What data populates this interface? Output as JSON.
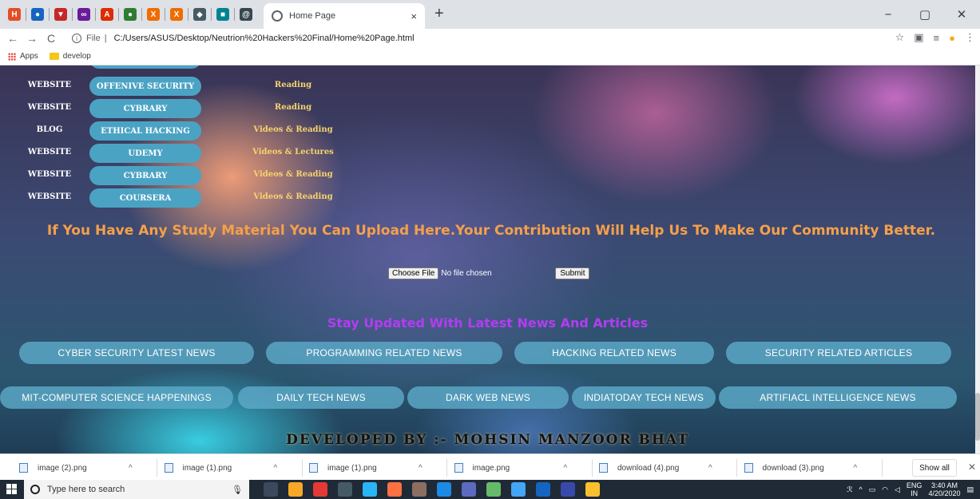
{
  "browser": {
    "pinned_tabs": [
      {
        "icon": "html-icon",
        "color": "#e44d26",
        "glyph": "H"
      },
      {
        "icon": "circle-icon",
        "color": "#1565c0",
        "glyph": "●"
      },
      {
        "icon": "shield-icon",
        "color": "#c62828",
        "glyph": "▼"
      },
      {
        "icon": "infinity-icon",
        "color": "#6a1b9a",
        "glyph": "∞"
      },
      {
        "icon": "angular-icon",
        "color": "#dd2c00",
        "glyph": "A"
      },
      {
        "icon": "whatsapp-icon",
        "color": "#2e7d32",
        "glyph": "●"
      },
      {
        "icon": "x-icon",
        "color": "#ef6c00",
        "glyph": "X"
      },
      {
        "icon": "x-icon",
        "color": "#ef6c00",
        "glyph": "X"
      },
      {
        "icon": "diamond-icon",
        "color": "#455a64",
        "glyph": "◆"
      },
      {
        "icon": "square-icon",
        "color": "#00838f",
        "glyph": "■"
      },
      {
        "icon": "at-icon",
        "color": "#37474f",
        "glyph": "@"
      }
    ],
    "active_tab_title": "Home Page",
    "tab_close": "×",
    "new_tab": "+",
    "window_controls": {
      "minimize": "−",
      "maximize": "▢",
      "close": "✕"
    },
    "back": "←",
    "forward": "→",
    "reload": "C",
    "url_scheme": "File",
    "url": "C:/Users/ASUS/Desktop/Neutrion%20Hackers%20Final/Home%20Page.html",
    "bookmarks": [
      {
        "label": "Apps",
        "icon": "apps-icon"
      },
      {
        "label": "develop",
        "icon": "folder-icon"
      }
    ]
  },
  "resources": [
    {
      "type": "WEBSITE",
      "name": "OFFENIVE SECURITY",
      "kind": "Reading"
    },
    {
      "type": "WEBSITE",
      "name": "CYBRARY",
      "kind": "Reading"
    },
    {
      "type": "BLOG",
      "name": "ETHICAL HACKING",
      "kind": "Videos & Reading"
    },
    {
      "type": "WEBSITE",
      "name": "UDEMY",
      "kind": "Videos & Lectures"
    },
    {
      "type": "WEBSITE",
      "name": "CYBRARY",
      "kind": "Videos & Reading"
    },
    {
      "type": "WEBSITE",
      "name": "COURSERA",
      "kind": "Videos & Reading"
    }
  ],
  "upload": {
    "heading": "If You Have Any Study Material You Can Upload Here.Your Contribution Will Help Us To Make Our Community Better.",
    "choose_label": "Choose File",
    "no_file": "No file chosen",
    "submit_label": "Submit"
  },
  "news": {
    "heading": "Stay Updated With Latest News And Articles",
    "row1": [
      "CYBER SECURITY LATEST NEWS",
      "PROGRAMMING RELATED NEWS",
      "HACKING RELATED NEWS",
      "SECURITY RELATED ARTICLES"
    ],
    "row2": [
      "MIT-COMPUTER SCIENCE HAPPENINGS",
      "DAILY TECH NEWS",
      "DARK WEB NEWS",
      "INDIATODAY TECH NEWS",
      "ARTIFIACL INTELLIGENCE NEWS"
    ]
  },
  "footer_credit": "DEVELOPED BY :- MOHSIN MANZOOR BHAT",
  "downloads": {
    "items": [
      "image (2).png",
      "image (1).png",
      "image (1).png",
      "image.png",
      "download (4).png",
      "download (3).png"
    ],
    "chevron": "^",
    "show_all": "Show all",
    "close": "✕"
  },
  "taskbar": {
    "search_placeholder": "Type here to search",
    "apps": [
      "#3a4a5c",
      "#f9a825",
      "#e53935",
      "#455a64",
      "#29b6f6",
      "#ff7043",
      "#8d6e63",
      "#1e88e5",
      "#5c6bc0",
      "#66bb6a",
      "#42a5f5",
      "#1565c0",
      "#3949ab",
      "#fbc02d"
    ],
    "lang_top": "ENG",
    "lang_bottom": "IN",
    "time": "3:40 AM",
    "date": "4/20/2020"
  }
}
